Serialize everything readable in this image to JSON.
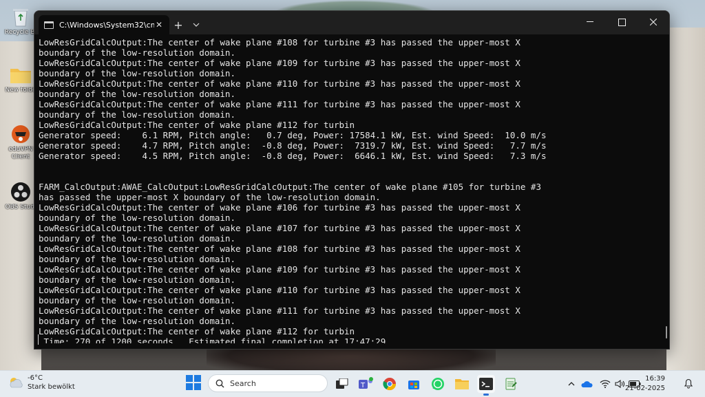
{
  "desktop": {
    "icons": [
      {
        "label": "Recycle Bi",
        "icon": "recycle-bin-icon"
      },
      {
        "label": "New folde",
        "icon": "folder-icon"
      },
      {
        "label": "eduVPN",
        "label2": "Client",
        "icon": "eduvpn-icon"
      },
      {
        "label": "OBS Studi",
        "icon": "obs-icon"
      }
    ]
  },
  "terminal": {
    "tab_title": "C:\\Windows\\System32\\cmd.e",
    "new_tab": "+",
    "tab_menu": "⌄",
    "output": "LowResGridCalcOutput:The center of wake plane #108 for turbine #3 has passed the upper-most X\nboundary of the low-resolution domain.\nLowResGridCalcOutput:The center of wake plane #109 for turbine #3 has passed the upper-most X\nboundary of the low-resolution domain.\nLowResGridCalcOutput:The center of wake plane #110 for turbine #3 has passed the upper-most X\nboundary of the low-resolution domain.\nLowResGridCalcOutput:The center of wake plane #111 for turbine #3 has passed the upper-most X\nboundary of the low-resolution domain.\nLowResGridCalcOutput:The center of wake plane #112 for turbin\nGenerator speed:    6.1 RPM, Pitch angle:   0.7 deg, Power: 17584.1 kW, Est. wind Speed:  10.0 m/s\nGenerator speed:    4.7 RPM, Pitch angle:  -0.8 deg, Power:  7319.7 kW, Est. wind Speed:   7.7 m/s\nGenerator speed:    4.5 RPM, Pitch angle:  -0.8 deg, Power:  6646.1 kW, Est. wind Speed:   7.3 m/s\n\n\nFARM_CalcOutput:AWAE_CalcOutput:LowResGridCalcOutput:The center of wake plane #105 for turbine #3\nhas passed the upper-most X boundary of the low-resolution domain.\nLowResGridCalcOutput:The center of wake plane #106 for turbine #3 has passed the upper-most X\nboundary of the low-resolution domain.\nLowResGridCalcOutput:The center of wake plane #107 for turbine #3 has passed the upper-most X\nboundary of the low-resolution domain.\nLowResGridCalcOutput:The center of wake plane #108 for turbine #3 has passed the upper-most X\nboundary of the low-resolution domain.\nLowResGridCalcOutput:The center of wake plane #109 for turbine #3 has passed the upper-most X\nboundary of the low-resolution domain.\nLowResGridCalcOutput:The center of wake plane #110 for turbine #3 has passed the upper-most X\nboundary of the low-resolution domain.\nLowResGridCalcOutput:The center of wake plane #111 for turbine #3 has passed the upper-most X\nboundary of the low-resolution domain.\nLowResGridCalcOutput:The center of wake plane #112 for turbin\n Time: 270 of 1200 seconds.  Estimated final completion at 17:47:29."
  },
  "taskbar": {
    "weather_temp": "-6°C",
    "weather_desc": "Stark bewölkt",
    "search_label": "Search",
    "apps": [
      "task-view-icon",
      "teams-icon",
      "chrome-icon",
      "store-icon",
      "whatsapp-icon",
      "file-explorer-icon",
      "terminal-icon",
      "notepad-icon"
    ],
    "time": "16:39",
    "date": "21-02-2025"
  },
  "colors": {
    "terminal_bg": "#0c0c0c",
    "terminal_text": "#e6e6e6",
    "titlebar_bg": "#1f1f1f",
    "taskbar_bg": "#e6ecf1",
    "accent": "#2b6fd6"
  }
}
